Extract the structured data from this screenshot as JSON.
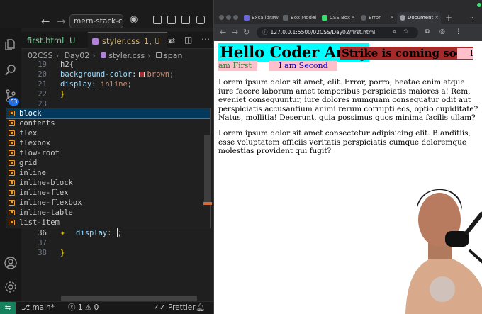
{
  "vscode": {
    "command_center": "mern-stack-cou",
    "tabs": [
      {
        "label": "first.html",
        "status": "U"
      },
      {
        "label": "styler.css",
        "status": "1, U"
      }
    ],
    "breadcrumb": [
      "02CSS",
      "Day02",
      "styler.css",
      "span"
    ],
    "source_control_badge": "53",
    "code_lines": [
      {
        "num": "19",
        "partial": "h2{"
      },
      {
        "num": "20",
        "prop": "background-color",
        "value": "brown"
      },
      {
        "num": "21",
        "prop": "display",
        "value": "inline"
      },
      {
        "num": "22",
        "text": "}"
      },
      {
        "num": "23",
        "text": ""
      },
      {
        "num": "36",
        "prop": "display",
        "value": ";"
      },
      {
        "num": "37",
        "text": ""
      },
      {
        "num": "38",
        "text": "}"
      }
    ],
    "suggestions": [
      "block",
      "contents",
      "flex",
      "flexbox",
      "flow-root",
      "grid",
      "inline",
      "inline-block",
      "inline-flex",
      "inline-flexbox",
      "inline-table",
      "list-item"
    ],
    "selected_suggestion": "block",
    "status": {
      "branch": "main*",
      "errors": "1",
      "warnings": "0",
      "formatter": "Prettier"
    }
  },
  "browser": {
    "tabs": [
      "Excalidraw",
      "Box Model",
      "CSS Box",
      "Error",
      "Document"
    ],
    "active_tab": "Document",
    "url": "127.0.0.1:5500/02CSS/Day02/first.html",
    "page": {
      "heading": "Hello Coder Army",
      "strike": "Strike is coming soon",
      "pink_stub": "I",
      "first": "am First",
      "second": "I am Second",
      "paragraph1": "Lorem ipsum dolor sit amet, elit. Error, porro, beatae enim atque iure facere laborum amet temporibus perspiciatis maiores a! Rem, eveniet consequuntur, iure dolores numquam consequatur odit aut perspiciatis accusantium animi rerum corrupti eos, optio cupiditate? Natus, mollitia! Deserunt, quia possimus quos minima facilis ullam?",
      "paragraph2": "Lorem ipsum dolor sit amet consectetur adipisicing elit. Blanditiis, esse voluptatem officiis veritatis perspiciatis cumque doloremque molestias provident qui fugit?"
    }
  },
  "colors": {
    "cyan": "#00ffff",
    "brown": "#a52a2a",
    "pink": "#ffc0cb",
    "vscode_accent": "#0078d4"
  }
}
